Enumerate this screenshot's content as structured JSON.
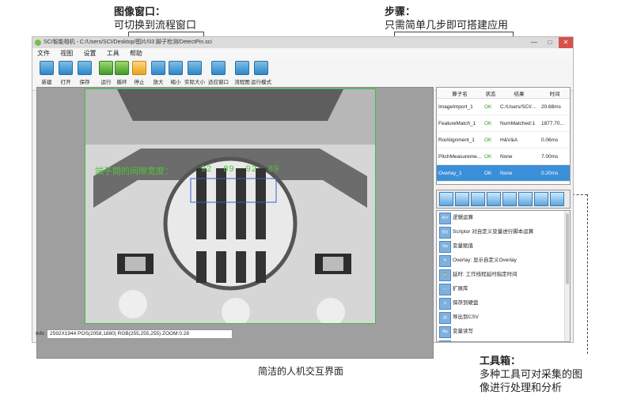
{
  "annotations": {
    "image_window": {
      "title": "图像窗口：",
      "desc": "可切换到流程窗口"
    },
    "steps": {
      "title": "步骤：",
      "desc": "只需简单几步即可搭建应用"
    },
    "toolbox": {
      "title": "工具箱：",
      "desc1": "多种工具可对采集的图",
      "desc2": "像进行处理和分析"
    },
    "caption": "简洁的人机交互界面"
  },
  "window": {
    "title": "SCI智能相机 - C:/Users/SCI/Desktop/图片/03 脚子检测/DetectPin.sci",
    "minimize": "—",
    "maximize": "□",
    "close": "✕"
  },
  "menu": [
    "文件",
    "视图",
    "设置",
    "工具",
    "帮助"
  ],
  "toolbar": [
    {
      "label": "新建",
      "icon": "new-file-icon",
      "color": "blue"
    },
    {
      "label": "打开",
      "icon": "open-file-icon",
      "color": "blue"
    },
    {
      "label": "保存",
      "icon": "save-icon",
      "color": "blue"
    },
    {
      "label": "运行",
      "icon": "run-icon",
      "color": "green"
    },
    {
      "label": "循环",
      "icon": "loop-icon",
      "color": "green"
    },
    {
      "label": "停止",
      "icon": "stop-icon",
      "color": "orange"
    },
    {
      "label": "放大",
      "icon": "zoom-in-icon",
      "color": "blue"
    },
    {
      "label": "缩小",
      "icon": "zoom-out-icon",
      "color": "blue"
    },
    {
      "label": "实际大小",
      "icon": "actual-size-icon",
      "color": "blue"
    },
    {
      "label": "适应窗口",
      "icon": "fit-window-icon",
      "color": "blue"
    },
    {
      "label": "流程图",
      "icon": "flowchart-icon",
      "color": "blue"
    },
    {
      "label": "运行模式",
      "icon": "run-mode-icon",
      "color": "blue"
    }
  ],
  "overlay": {
    "label": "端子間的间隙宽度：",
    "values": [
      "92",
      "89",
      "92",
      "89"
    ]
  },
  "info": {
    "label": "Info",
    "text": "2592X1944  POS(2058,1880)  RGB(255,255,255)  ZOOM:0.28"
  },
  "steps_table": {
    "headers": [
      "算子名",
      "状态",
      "结果",
      "时间"
    ],
    "rows": [
      {
        "name": "ImageImport_1",
        "status": "OK",
        "result": "C:/Users/SCI/D...",
        "time": "20.68ms",
        "selected": false
      },
      {
        "name": "FeatureMatch_1",
        "status": "OK",
        "result": "NumMatched:1",
        "time": "1877.70...",
        "selected": false
      },
      {
        "name": "RoiAlignment_1",
        "status": "OK",
        "result": "H&V&A",
        "time": "0.06ms",
        "selected": false
      },
      {
        "name": "PitchMeasureme...",
        "status": "OK",
        "result": "None",
        "time": "7.00ms",
        "selected": false
      },
      {
        "name": "Overlay_1",
        "status": "OK",
        "result": "None",
        "time": "0.20ms",
        "selected": true
      }
    ]
  },
  "toolbox_tabs": [
    "image-tool-icon",
    "color-tool-icon",
    "measure-tool-icon",
    "calc-tool-icon",
    "search-tool-icon",
    "code-tool-icon",
    "io-tool-icon",
    "window-tool-icon"
  ],
  "tools": [
    {
      "icon": "A/V",
      "label": "逻辑运算"
    },
    {
      "icon": "f(x)",
      "label": "Scriptor 对自定义变量进行脚本运算"
    },
    {
      "icon": "Var",
      "label": "变量赋值"
    },
    {
      "icon": "✎",
      "label": "Overlay: 显示自定义Overlay"
    },
    {
      "icon": "⌛",
      "label": "延时: 工作线程延时指定时间"
    },
    {
      "icon": "⋯",
      "label": "扩展库"
    },
    {
      "icon": "≡",
      "label": "保存到硬盘"
    },
    {
      "icon": "▤",
      "label": "导出到CSV"
    },
    {
      "icon": "Aa",
      "label": "变量读写"
    },
    {
      "icon": "⇆",
      "label": "通讯助手"
    }
  ]
}
